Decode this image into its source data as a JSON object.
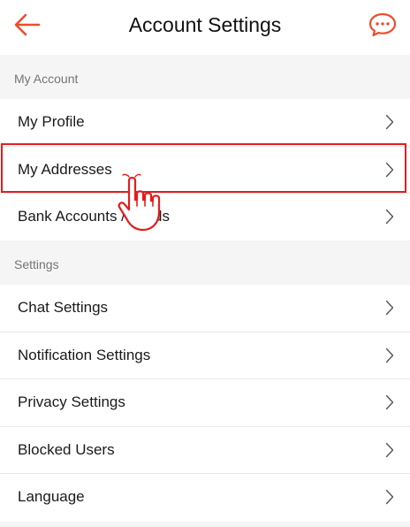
{
  "header": {
    "title": "Account Settings",
    "back_icon": "arrow-left-icon",
    "chat_icon": "chat-bubbles-icon",
    "accent_color": "#ee4d2d"
  },
  "sections": [
    {
      "title": "My Account",
      "items": [
        {
          "label": "My Profile"
        },
        {
          "label": "My Addresses"
        },
        {
          "label": "Bank Accounts / Cards"
        }
      ]
    },
    {
      "title": "Settings",
      "items": [
        {
          "label": "Chat Settings"
        },
        {
          "label": "Notification Settings"
        },
        {
          "label": "Privacy Settings"
        },
        {
          "label": "Blocked Users"
        },
        {
          "label": "Language"
        }
      ]
    }
  ],
  "annotation": {
    "highlighted_item": "My Addresses",
    "highlight_color": "#e01e1e",
    "pointer_icon": "hand-pointer-icon"
  }
}
